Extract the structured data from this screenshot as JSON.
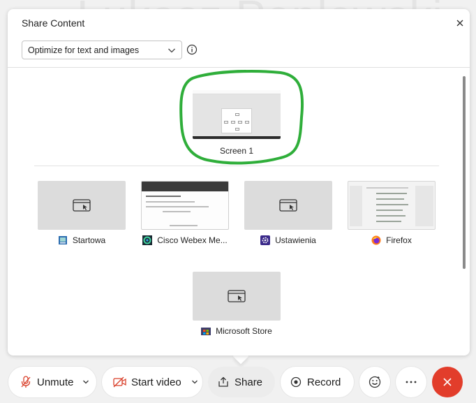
{
  "background": {
    "presenter_name": "Łukasz Pepłowski"
  },
  "share_panel": {
    "title": "Share Content",
    "optimize_dropdown": {
      "selected": "Optimize for text and images"
    },
    "screens": [
      {
        "label": "Screen 1"
      }
    ],
    "applications": [
      {
        "label": "Startowa",
        "icon": "window-app-icon"
      },
      {
        "label": "Cisco Webex Me...",
        "icon": "webex-icon"
      },
      {
        "label": "Ustawienia",
        "icon": "gear-icon"
      },
      {
        "label": "Firefox",
        "icon": "firefox-icon"
      },
      {
        "label": "Microsoft Store",
        "icon": "store-icon"
      }
    ]
  },
  "toolbar": {
    "unmute_label": "Unmute",
    "start_video_label": "Start video",
    "share_label": "Share",
    "record_label": "Record"
  },
  "colors": {
    "highlight": "#2fae3a",
    "end_call": "#e23d2b",
    "mute_red": "#d9402b"
  }
}
